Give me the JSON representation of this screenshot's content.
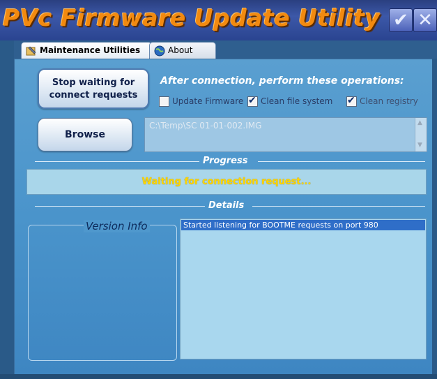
{
  "window": {
    "title": "PVc Firmware Update Utility",
    "minimize_glyph": "✔",
    "close_glyph": "✕"
  },
  "tabs": [
    {
      "label": "Maintenance Utilities",
      "icon": "tools-icon",
      "active": true
    },
    {
      "label": "About",
      "icon": "globe-icon",
      "active": false
    }
  ],
  "buttons": {
    "stop_line1": "Stop waiting for",
    "stop_line2": "connect requests",
    "browse": "Browse"
  },
  "operations": {
    "heading": "After connection, perform these operations:",
    "options": [
      {
        "label": "Update Firmware",
        "checked": false
      },
      {
        "label": "Clean file system",
        "checked": true
      },
      {
        "label": "Clean registry",
        "checked": true,
        "disabled": true
      }
    ]
  },
  "file_path": "C:\\Temp\\SC 01-01-002.IMG",
  "progress": {
    "heading": "Progress",
    "message": "Waiting for connection request..."
  },
  "details": {
    "heading": "Details",
    "version_label": "Version Info",
    "log": [
      "Started listening for BOOTME requests on port 980"
    ]
  },
  "colors": {
    "title_orange": "#f28a10",
    "panel_blue": "#4a94cb",
    "progress_text": "#ffd600",
    "selection": "#2f6ec8"
  }
}
